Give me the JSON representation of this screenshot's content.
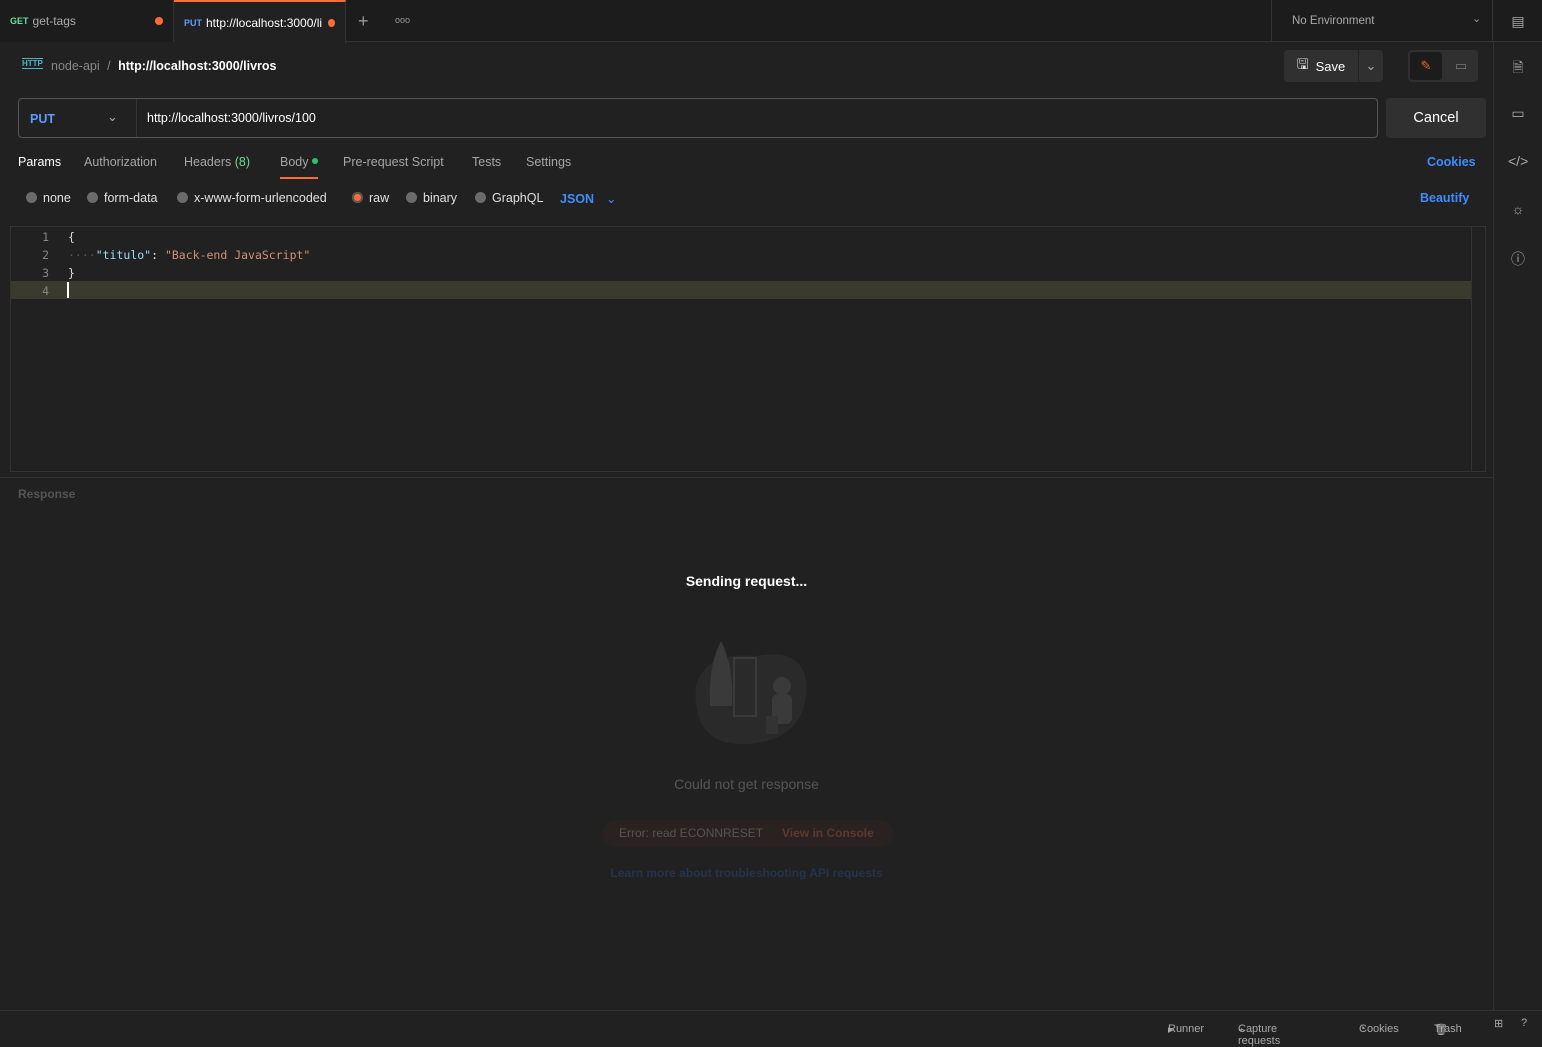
{
  "tabs": [
    {
      "method": "GET",
      "name": "get-tags",
      "unsaved": true,
      "active": false
    },
    {
      "method": "PUT",
      "name": "http://localhost:3000/li",
      "unsaved": true,
      "active": true
    }
  ],
  "tab_actions": {
    "new": "+",
    "more": "ooo"
  },
  "environment": {
    "selected": "No Environment"
  },
  "breadcrumb": {
    "collection": "node-api",
    "separator": "/",
    "request": "http://localhost:3000/livros"
  },
  "toolbar": {
    "save_label": "Save"
  },
  "request": {
    "method": "PUT",
    "url": "http://localhost:3000/livros/100",
    "cancel_label": "Cancel"
  },
  "request_tabs": {
    "params": "Params",
    "authorization": "Authorization",
    "headers": "Headers",
    "headers_count": "(8)",
    "body": "Body",
    "pre_request": "Pre-request Script",
    "tests": "Tests",
    "settings": "Settings",
    "cookies": "Cookies"
  },
  "body_options": {
    "none": "none",
    "form_data": "form-data",
    "urlencoded": "x-www-form-urlencoded",
    "raw": "raw",
    "binary": "binary",
    "graphql": "GraphQL",
    "format": "JSON",
    "beautify": "Beautify",
    "selected": "raw"
  },
  "editor": {
    "line_numbers": [
      "1",
      "2",
      "3",
      "4"
    ],
    "lines": {
      "open": "{",
      "key": "\"titulo\"",
      "colon": ": ",
      "value": "\"Back-end JavaScript\"",
      "close": "}"
    }
  },
  "response": {
    "label": "Response",
    "sending": "Sending request...",
    "message": "Could not get response",
    "error": "Error: read ECONNRESET",
    "console_link": "View in Console",
    "learn_more": "Learn more about troubleshooting API requests"
  },
  "statusbar": {
    "runner": "Runner",
    "capture": "Capture requests",
    "cookies": "Cookies",
    "trash": "Trash"
  },
  "colors": {
    "accent": "#ff6c37",
    "method_put": "#5c9dff",
    "method_get": "#6bdd9a",
    "link": "#3f8cff"
  }
}
